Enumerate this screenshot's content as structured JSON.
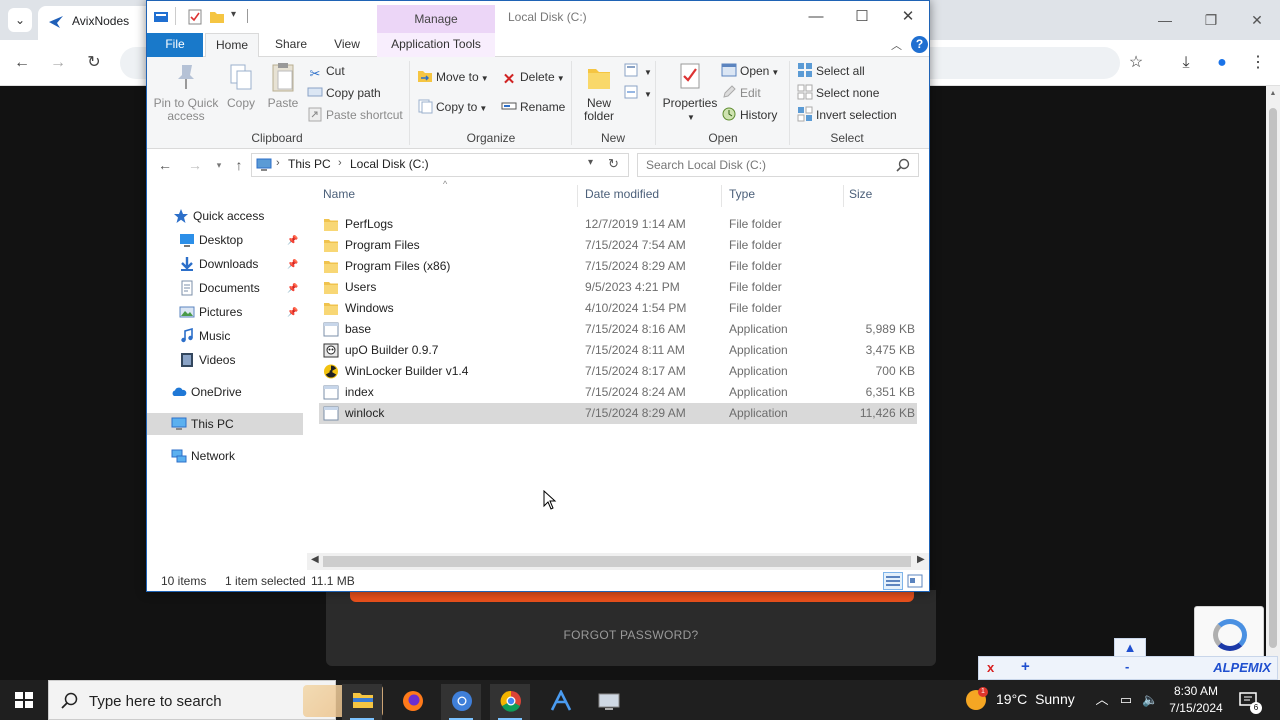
{
  "browser": {
    "tab_title": "AvixNodes",
    "forgot_password": "FORGOT PASSWORD?",
    "alpemix": {
      "close": "x",
      "add": "+",
      "minimize": "-",
      "brand": "ALPEMIX",
      "expand": "▲"
    }
  },
  "explorer": {
    "manage_label": "Manage",
    "window_title": "Local Disk (C:)",
    "tabs": {
      "file": "File",
      "home": "Home",
      "share": "Share",
      "view": "View",
      "app_tools": "Application Tools"
    },
    "ribbon": {
      "clipboard": {
        "label": "Clipboard",
        "pin": "Pin to Quick access",
        "copy": "Copy",
        "paste": "Paste",
        "cut": "Cut",
        "copy_path": "Copy path",
        "paste_shortcut": "Paste shortcut"
      },
      "organize": {
        "label": "Organize",
        "move_to": "Move to",
        "copy_to": "Copy to",
        "delete": "Delete",
        "rename": "Rename"
      },
      "new": {
        "label": "New",
        "new_folder": "New folder"
      },
      "open": {
        "label": "Open",
        "properties": "Properties",
        "open": "Open",
        "edit": "Edit",
        "history": "History"
      },
      "select": {
        "label": "Select",
        "select_all": "Select all",
        "select_none": "Select none",
        "invert": "Invert selection"
      }
    },
    "address": {
      "parts": [
        "This PC",
        "Local Disk (C:)"
      ],
      "search_placeholder": "Search Local Disk (C:)"
    },
    "nav": [
      {
        "label": "Quick access",
        "icon": "star-icon"
      },
      {
        "label": "Desktop",
        "icon": "desktop-icon",
        "pinned": true
      },
      {
        "label": "Downloads",
        "icon": "download-icon",
        "pinned": true
      },
      {
        "label": "Documents",
        "icon": "documents-icon",
        "pinned": true
      },
      {
        "label": "Pictures",
        "icon": "pictures-icon",
        "pinned": true
      },
      {
        "label": "Music",
        "icon": "music-icon"
      },
      {
        "label": "Videos",
        "icon": "videos-icon"
      },
      {
        "label": "OneDrive",
        "icon": "cloud-icon"
      },
      {
        "label": "This PC",
        "icon": "computer-icon",
        "selected": true
      },
      {
        "label": "Network",
        "icon": "network-icon"
      }
    ],
    "columns": {
      "name": "Name",
      "date": "Date modified",
      "type": "Type",
      "size": "Size"
    },
    "files": [
      {
        "name": "PerfLogs",
        "date": "12/7/2019 1:14 AM",
        "type": "File folder",
        "size": "",
        "icon": "folder-icon"
      },
      {
        "name": "Program Files",
        "date": "7/15/2024 7:54 AM",
        "type": "File folder",
        "size": "",
        "icon": "folder-icon"
      },
      {
        "name": "Program Files (x86)",
        "date": "7/15/2024 8:29 AM",
        "type": "File folder",
        "size": "",
        "icon": "folder-icon"
      },
      {
        "name": "Users",
        "date": "9/5/2023 4:21 PM",
        "type": "File folder",
        "size": "",
        "icon": "folder-icon"
      },
      {
        "name": "Windows",
        "date": "4/10/2024 1:54 PM",
        "type": "File folder",
        "size": "",
        "icon": "folder-icon"
      },
      {
        "name": "base",
        "date": "7/15/2024 8:16 AM",
        "type": "Application",
        "size": "5,989 KB",
        "icon": "application-icon"
      },
      {
        "name": "upO Builder 0.9.7",
        "date": "7/15/2024 8:11 AM",
        "type": "Application",
        "size": "3,475 KB",
        "icon": "skull-icon"
      },
      {
        "name": "WinLocker Builder v1.4",
        "date": "7/15/2024 8:17 AM",
        "type": "Application",
        "size": "700 KB",
        "icon": "radiation-icon"
      },
      {
        "name": "index",
        "date": "7/15/2024 8:24 AM",
        "type": "Application",
        "size": "6,351 KB",
        "icon": "application-icon"
      },
      {
        "name": "winlock",
        "date": "7/15/2024 8:29 AM",
        "type": "Application",
        "size": "11,426 KB",
        "icon": "application-icon",
        "selected": true
      }
    ],
    "status": {
      "count": "10 items",
      "selected": "1 item selected",
      "size": "11.1 MB"
    }
  },
  "taskbar": {
    "search_placeholder": "Type here to search",
    "weather_temp": "19°C",
    "weather_cond": "Sunny",
    "time": "8:30 AM",
    "date": "7/15/2024",
    "notification_count": "6"
  }
}
